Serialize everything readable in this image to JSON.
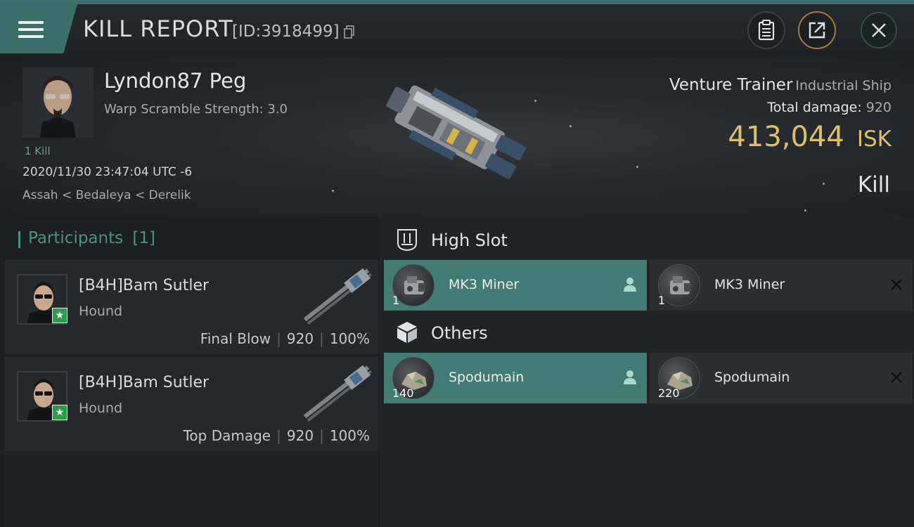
{
  "header": {
    "title": "KILL REPORT",
    "report_id": "[ID:3918499]",
    "icons": [
      "menu-icon",
      "copy-icon",
      "clipboard-icon",
      "share-icon",
      "close-icon"
    ]
  },
  "victim": {
    "name": "Lyndon87 Peg",
    "warp_scramble": "Warp Scramble Strength: 3.0",
    "kill_count": "1 Kill",
    "timestamp": "2020/11/30 23:47:04 UTC -6",
    "location": "Assah < Bedaleya < Derelik",
    "ship_name": "Venture Trainer",
    "ship_type": "Industrial Ship",
    "total_damage_label": "Total damage:",
    "total_damage_value": "920",
    "isk_value": "413,044",
    "isk_unit": "ISK",
    "result": "Kill"
  },
  "participants": {
    "label": "Participants",
    "count": "[1]",
    "rows": [
      {
        "name": "[B4H]Bam Sutler",
        "ship": "Hound",
        "role": "Final Blow",
        "damage": "920",
        "percent": "100%"
      },
      {
        "name": "[B4H]Bam Sutler",
        "ship": "Hound",
        "role": "Top Damage",
        "damage": "920",
        "percent": "100%"
      }
    ]
  },
  "sections": {
    "high_slot": {
      "label": "High Slot",
      "items": [
        {
          "qty": "1",
          "name": "MK3 Miner",
          "state": "dropped"
        },
        {
          "qty": "1",
          "name": "MK3 Miner",
          "state": "destroyed"
        }
      ]
    },
    "others": {
      "label": "Others",
      "items": [
        {
          "qty": "140",
          "name": "Spodumain",
          "state": "dropped"
        },
        {
          "qty": "220",
          "name": "Spodumain",
          "state": "destroyed"
        }
      ]
    }
  },
  "colors": {
    "accent": "#427c75",
    "isk": "#e0bf6b",
    "participants_title": "#4f8f88",
    "badge": "#2e9b4c"
  }
}
